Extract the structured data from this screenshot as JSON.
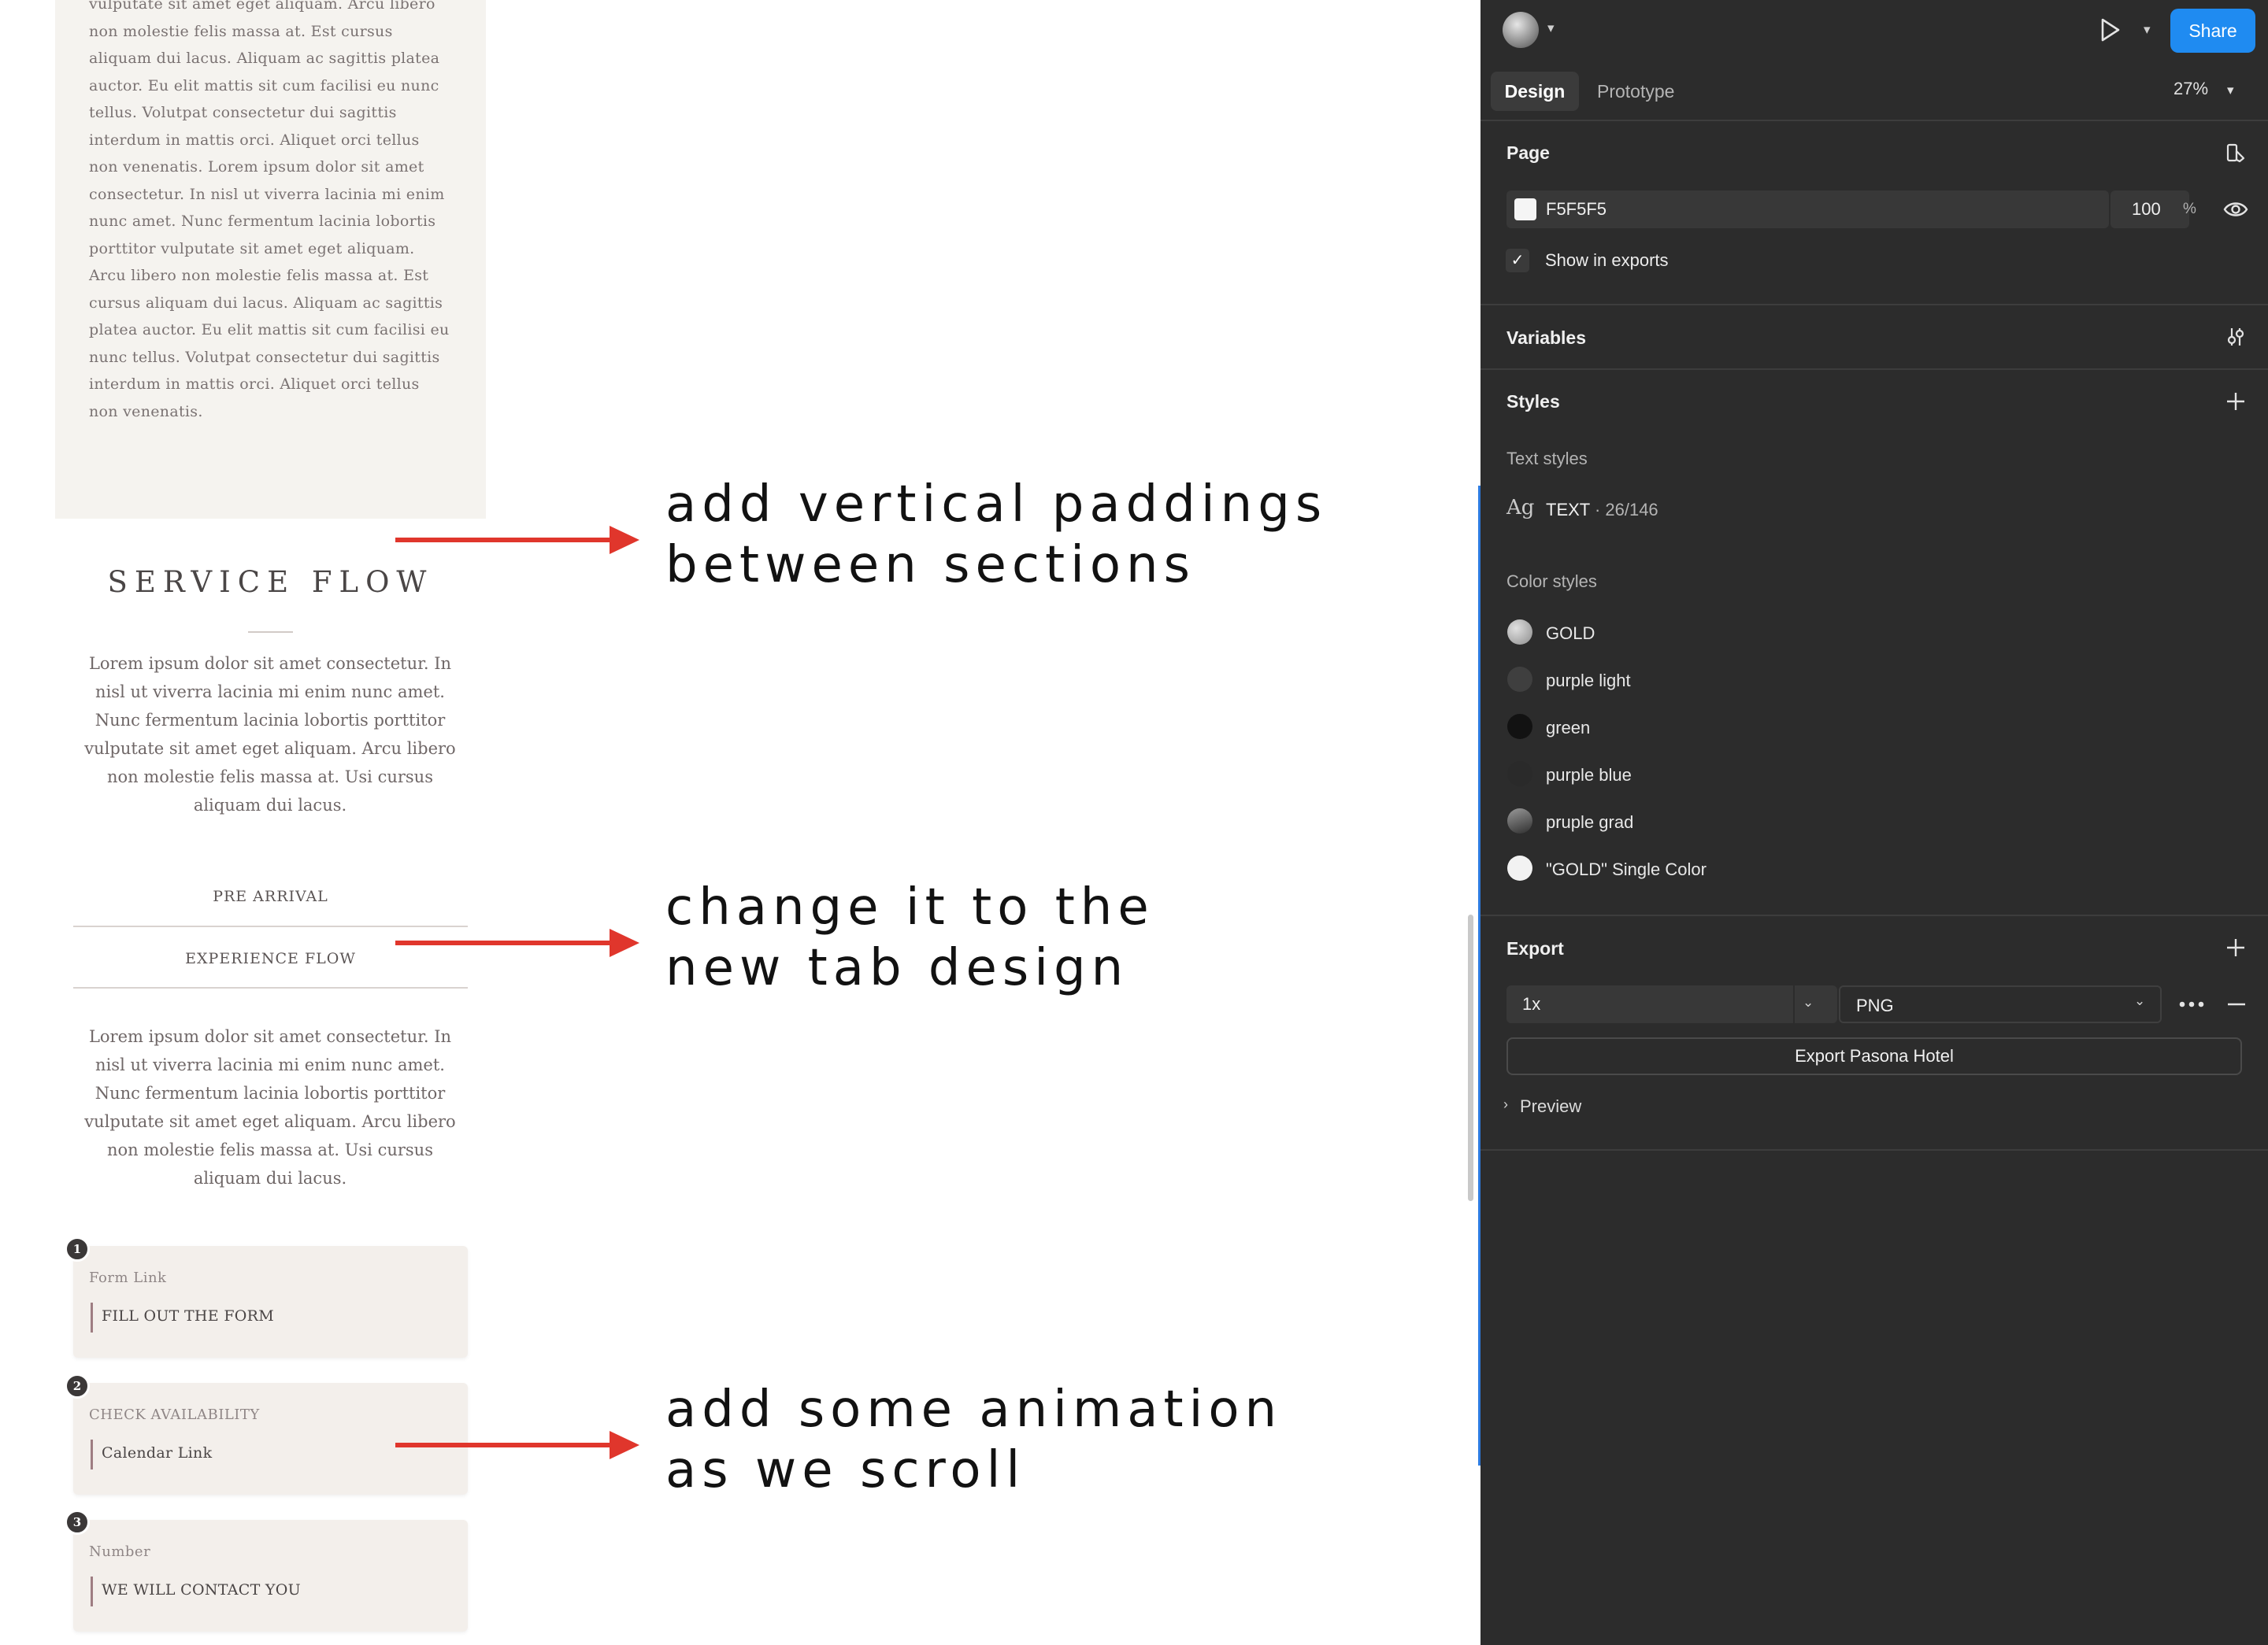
{
  "canvas": {
    "lorem_top": "vulputate sit amet eget aliquam. Arcu libero non molestie felis massa at. Est cursus aliquam dui lacus. Aliquam ac sagittis platea auctor. Eu elit mattis sit cum facilisi eu nunc tellus. Volutpat consectetur dui sagittis interdum in mattis orci. Aliquet orci tellus non venenatis. Lorem ipsum dolor sit amet consectetur. In nisl ut viverra lacinia mi enim nunc amet. Nunc fermentum lacinia lobortis porttitor vulputate sit amet eget aliquam. Arcu libero non molestie felis massa at. Est cursus aliquam dui lacus. Aliquam ac sagittis platea auctor. Eu elit mattis sit cum facilisi eu nunc tellus. Volutpat consectetur dui sagittis interdum in mattis orci. Aliquet orci tellus non venenatis.",
    "service_flow_title": "SERVICE FLOW",
    "intro_paragraph": "Lorem ipsum dolor sit amet consectetur. In nisl ut viverra lacinia mi enim nunc amet. Nunc fermentum lacinia lobortis porttitor vulputate sit amet eget aliquam. Arcu libero non molestie felis massa at. Usi cursus aliquam dui lacus.",
    "tabs": [
      "PRE ARRIVAL",
      "EXPERIENCE FLOW"
    ],
    "tab_paragraph": "Lorem ipsum dolor sit amet consectetur. In nisl ut viverra lacinia mi enim nunc amet. Nunc fermentum lacinia lobortis porttitor vulputate sit amet eget aliquam. Arcu libero non molestie felis massa at. Usi cursus aliquam dui lacus.",
    "steps": [
      {
        "num": "1",
        "label": "Form Link",
        "value": "FILL OUT THE FORM"
      },
      {
        "num": "2",
        "label": "CHECK AVAILABILITY",
        "value": "Calendar Link"
      },
      {
        "num": "3",
        "label": "Number",
        "value": "WE WILL CONTACT YOU"
      }
    ]
  },
  "annotations": [
    "add vertical paddings\nbetween sections",
    "change it to the\nnew tab design",
    "add some animation\nas we scroll"
  ],
  "colors": {
    "annotation_arrow": "#e0362c",
    "share_button": "#1f8bf1",
    "selection_line": "#2d7be0"
  },
  "panel": {
    "share_label": "Share",
    "tabs": {
      "design": "Design",
      "prototype": "Prototype"
    },
    "zoom": "27%",
    "page": {
      "title": "Page",
      "color_hex": "F5F5F5",
      "opacity": "100",
      "opacity_unit": "%",
      "show_in_exports": "Show in exports"
    },
    "variables_title": "Variables",
    "styles": {
      "title": "Styles",
      "text_styles_title": "Text styles",
      "text_style_glyph": "Ag",
      "text_style_name": "TEXT",
      "text_style_detail": " · 26/146",
      "color_styles_title": "Color styles",
      "color_styles": [
        {
          "name": "GOLD",
          "swatch": "radial-gradient(circle at 35% 35%, #e0e0e0, #8c8c8c)"
        },
        {
          "name": "purple light",
          "swatch": "#3f3f3f"
        },
        {
          "name": "green",
          "swatch": "#121212"
        },
        {
          "name": "purple blue",
          "swatch": "#2a2a2a"
        },
        {
          "name": "pruple grad",
          "swatch": "linear-gradient(160deg, #9a9a9a, #2f2f2f)"
        },
        {
          "name": "\"GOLD\" Single Color",
          "swatch": "#f2f2f2"
        }
      ]
    },
    "export": {
      "title": "Export",
      "scale": "1x",
      "format": "PNG",
      "button_label": "Export Pasona Hotel",
      "preview_label": "Preview"
    }
  }
}
